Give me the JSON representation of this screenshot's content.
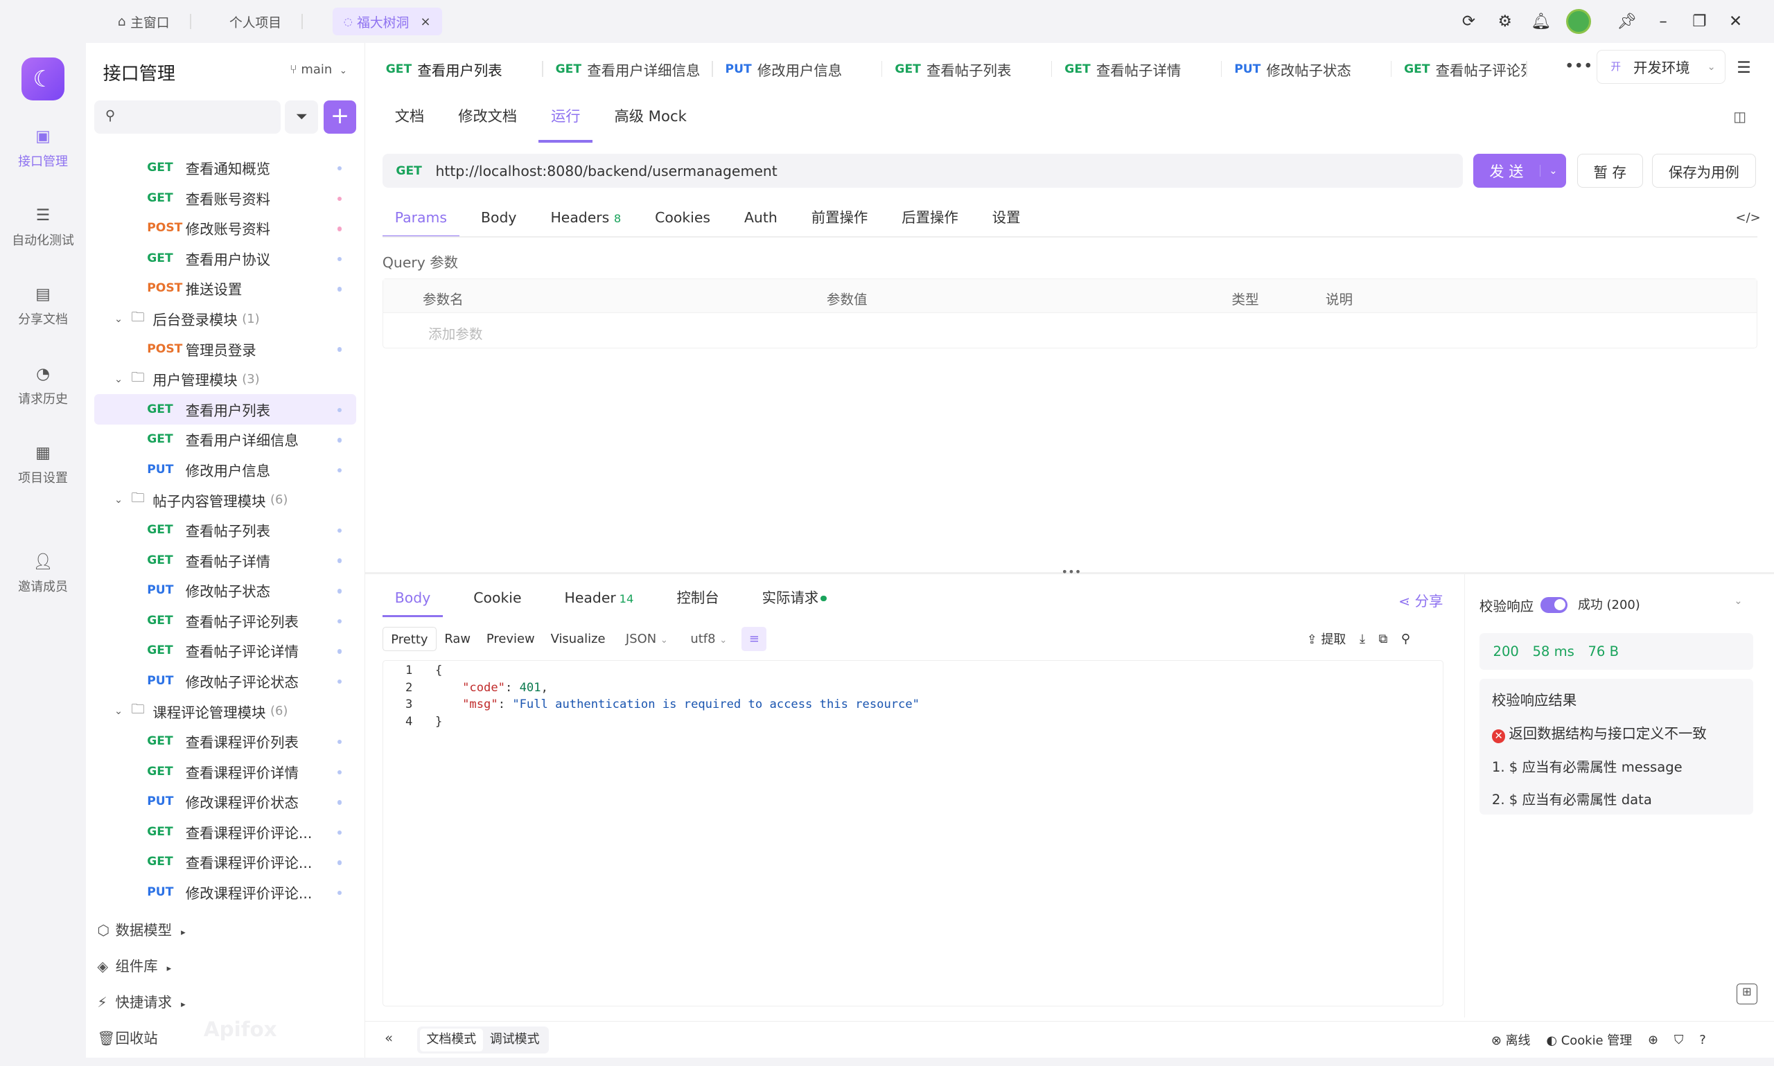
{
  "window_tabs": [
    {
      "label": "主窗口",
      "icon": "home-icon"
    },
    {
      "label": "个人项目"
    },
    {
      "label": "福大树洞",
      "close": "×"
    }
  ],
  "top_icons": [
    "refresh-icon",
    "settings-icon",
    "bell-icon",
    "user-avatar",
    "pin-icon",
    "minimize-icon",
    "restore-icon",
    "close-icon"
  ],
  "left_nav": [
    {
      "label": "接口管理",
      "icon": "api-icon"
    },
    {
      "label": "自动化测试",
      "icon": "test-icon"
    },
    {
      "label": "分享文档",
      "icon": "doc-share-icon"
    },
    {
      "label": "请求历史",
      "icon": "history-icon"
    },
    {
      "label": "项目设置",
      "icon": "project-settings-icon"
    },
    {
      "label": "邀请成员",
      "icon": "invite-icon"
    }
  ],
  "sidebar": {
    "title": "接口管理",
    "branch": "main",
    "tree": [
      {
        "type": "api",
        "method": "GET",
        "name": "查看通知概览",
        "dot": "blue"
      },
      {
        "type": "api",
        "method": "GET",
        "name": "查看账号资料",
        "dot": "pink"
      },
      {
        "type": "api",
        "method": "POST",
        "name": "修改账号资料",
        "dot": "pink"
      },
      {
        "type": "api",
        "method": "GET",
        "name": "查看用户协议",
        "dot": "blue"
      },
      {
        "type": "api",
        "method": "POST",
        "name": "推送设置",
        "dot": "blue"
      },
      {
        "type": "folder",
        "name": "后台登录模块",
        "count": "(1)"
      },
      {
        "type": "api",
        "method": "POST",
        "name": "管理员登录",
        "dot": "blue"
      },
      {
        "type": "folder",
        "name": "用户管理模块",
        "count": "(3)"
      },
      {
        "type": "api",
        "method": "GET",
        "name": "查看用户列表",
        "dot": "blue",
        "selected": true
      },
      {
        "type": "api",
        "method": "GET",
        "name": "查看用户详细信息",
        "dot": "blue"
      },
      {
        "type": "api",
        "method": "PUT",
        "name": "修改用户信息",
        "dot": "blue"
      },
      {
        "type": "folder",
        "name": "帖子内容管理模块",
        "count": "(6)"
      },
      {
        "type": "api",
        "method": "GET",
        "name": "查看帖子列表",
        "dot": "blue"
      },
      {
        "type": "api",
        "method": "GET",
        "name": "查看帖子详情",
        "dot": "blue"
      },
      {
        "type": "api",
        "method": "PUT",
        "name": "修改帖子状态",
        "dot": "blue"
      },
      {
        "type": "api",
        "method": "GET",
        "name": "查看帖子评论列表",
        "dot": "blue"
      },
      {
        "type": "api",
        "method": "GET",
        "name": "查看帖子评论详情",
        "dot": "blue"
      },
      {
        "type": "api",
        "method": "PUT",
        "name": "修改帖子评论状态",
        "dot": "blue"
      },
      {
        "type": "folder",
        "name": "课程评论管理模块",
        "count": "(6)"
      },
      {
        "type": "api",
        "method": "GET",
        "name": "查看课程评价列表",
        "dot": "blue"
      },
      {
        "type": "api",
        "method": "GET",
        "name": "查看课程评价详情",
        "dot": "blue"
      },
      {
        "type": "api",
        "method": "PUT",
        "name": "修改课程评价状态",
        "dot": "blue"
      },
      {
        "type": "api",
        "method": "GET",
        "name": "查看课程评价评论...",
        "dot": "blue"
      },
      {
        "type": "api",
        "method": "GET",
        "name": "查看课程评价评论...",
        "dot": "blue"
      },
      {
        "type": "api",
        "method": "PUT",
        "name": "修改课程评价评论...",
        "dot": "blue"
      }
    ],
    "bottom": [
      {
        "label": "数据模型",
        "icon": "cube-icon",
        "arrow": "▸"
      },
      {
        "label": "组件库",
        "icon": "layers-icon",
        "arrow": "▸"
      },
      {
        "label": "快捷请求",
        "icon": "quick-request-icon",
        "arrow": "▸"
      },
      {
        "label": "回收站",
        "icon": "trash-icon"
      }
    ],
    "watermark": "Apifox"
  },
  "editor_tabs": [
    {
      "method": "GET",
      "name": "查看用户列表"
    },
    {
      "method": "GET",
      "name": "查看用户详细信息"
    },
    {
      "method": "PUT",
      "name": "修改用户信息"
    },
    {
      "method": "GET",
      "name": "查看帖子列表"
    },
    {
      "method": "GET",
      "name": "查看帖子详情"
    },
    {
      "method": "PUT",
      "name": "修改帖子状态"
    },
    {
      "method": "GET",
      "name": "查看帖子评论列"
    }
  ],
  "more_tabs": "•••",
  "env": {
    "badge": "开",
    "name": "开发环境"
  },
  "sub_tabs": [
    "文档",
    "修改文档",
    "运行",
    "高级 Mock"
  ],
  "request": {
    "method": "GET",
    "url": "http://localhost:8080/backend/usermanagement",
    "send": "发 送",
    "save_draft": "暂 存",
    "save_case": "保存为用例"
  },
  "req_tabs": [
    {
      "label": "Params"
    },
    {
      "label": "Body"
    },
    {
      "label": "Headers",
      "badge": "8"
    },
    {
      "label": "Cookies"
    },
    {
      "label": "Auth"
    },
    {
      "label": "前置操作"
    },
    {
      "label": "后置操作"
    },
    {
      "label": "设置"
    }
  ],
  "query": {
    "label": "Query 参数",
    "headers": [
      "参数名",
      "参数值",
      "类型",
      "说明"
    ],
    "placeholder": "添加参数"
  },
  "resp_tabs": [
    {
      "label": "Body"
    },
    {
      "label": "Cookie"
    },
    {
      "label": "Header",
      "badge": "14"
    },
    {
      "label": "控制台"
    },
    {
      "label": "实际请求"
    }
  ],
  "share": "分享",
  "format_bar": {
    "modes": [
      "Pretty",
      "Raw",
      "Preview",
      "Visualize"
    ],
    "type": "JSON",
    "encoding": "utf8",
    "extract": "提取"
  },
  "response_code": [
    {
      "n": "1",
      "t": "{"
    },
    {
      "n": "2",
      "key": "\"code\"",
      "sep": ": ",
      "val": "401",
      "vtype": "num",
      "end": ","
    },
    {
      "n": "3",
      "key": "\"msg\"",
      "sep": ": ",
      "val": "\"Full authentication is required to access this resource\"",
      "vtype": "str",
      "end": ""
    },
    {
      "n": "4",
      "t": "}"
    }
  ],
  "validation": {
    "label": "校验响应",
    "status": "成功 (200)",
    "code": "200",
    "time": "58 ms",
    "size": "76 B",
    "result_title": "校验响应结果",
    "error": "返回数据结构与接口定义不一致",
    "items": [
      "1. $ 应当有必需属性 message",
      "2. $ 应当有必需属性 data"
    ]
  },
  "statusbar": {
    "modes": [
      "文档模式",
      "调试模式"
    ],
    "offline": "离线",
    "cookie": "Cookie 管理"
  },
  "colors": {
    "accent": "#8e72f0",
    "get": "#19a35b",
    "post": "#e8722c",
    "put": "#2d73e6"
  }
}
